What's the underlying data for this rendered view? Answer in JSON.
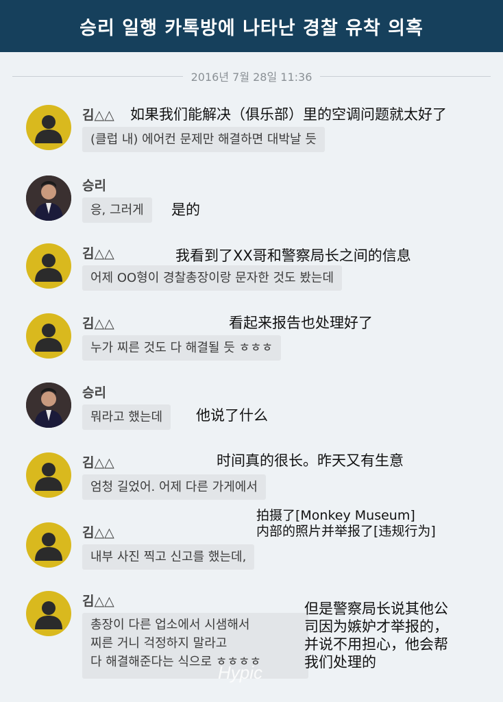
{
  "title": "승리 일행 카톡방에 나타난 경찰 유착 의혹",
  "date": "2016년 7월 28일 11:36",
  "watermark": "Hypic",
  "messages": [
    {
      "sender": "김△△",
      "text": "(클럽 내) 에어컨 문제만 해결하면 대박날 듯",
      "translation": "如果我们能解决（俱乐部）里的空调问题就太好了"
    },
    {
      "sender": "승리",
      "text": "응, 그러게",
      "translation": "是的"
    },
    {
      "sender": "김△△",
      "text": "어제 OO형이 경찰총장이랑 문자한 것도 봤는데",
      "translation": "我看到了XX哥和警察局长之间的信息"
    },
    {
      "sender": "김△△",
      "text": "누가 찌른 것도 다 해결될 듯 ㅎㅎㅎ",
      "translation": "看起来报告也处理好了"
    },
    {
      "sender": "승리",
      "text": "뭐라고 했는데",
      "translation": "他说了什么"
    },
    {
      "sender": "김△△",
      "text": "엄청 길었어. 어제 다른 가게에서",
      "translation": "时间真的很长。昨天又有生意"
    },
    {
      "sender": "김△△",
      "text": "내부 사진 찍고 신고를 했는데,",
      "translation_lines": [
        "拍摄了[Monkey Museum]",
        "内部的照片并举报了[违规行为]"
      ]
    },
    {
      "sender": "김△△",
      "text_lines": [
        "총장이 다른 업소에서 시샘해서",
        "찌른 거니 걱정하지 말라고",
        "다 해결해준다는 식으로 ㅎㅎㅎㅎ"
      ],
      "translation_lines": [
        "但是警察局长说其他公",
        "司因为嫉妒才举报的，",
        "并说不用担心，他会帮",
        "我们处理的"
      ]
    }
  ]
}
